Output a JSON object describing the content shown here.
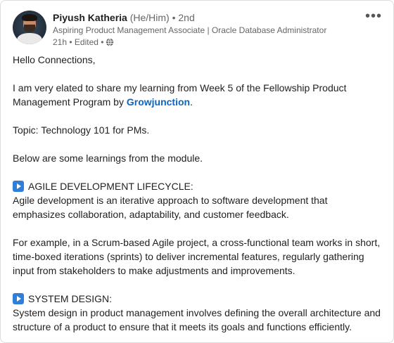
{
  "author": {
    "name": "Piyush Katheria",
    "pronouns": "(He/Him)",
    "degree": "• 2nd",
    "headline": "Aspiring Product Management Associate | Oracle Database Administrator",
    "time": "21h • Edited •",
    "visibility_icon": "globe-icon"
  },
  "menu_icon": "more-options-icon",
  "post": {
    "greeting": "Hello Connections,",
    "intro_before_link": "I am very elated to share my learning from Week 5 of the Fellowship Product Management Program by ",
    "intro_link": "Growjunction",
    "intro_after_link": ".",
    "topic": "Topic: Technology 101 for PMs.",
    "below": "Below are some learnings from the module.",
    "section1_heading": "AGILE DEVELOPMENT LIFECYCLE:",
    "section1_text": "Agile development is an iterative approach to software development that emphasizes collaboration, adaptability, and customer feedback.",
    "section1_example": "For example, in a Scrum-based Agile project, a cross-functional team works in short, time-boxed iterations (sprints) to deliver incremental features, regularly gathering input from stakeholders to make adjustments and improvements.",
    "section2_heading": "SYSTEM DESIGN:",
    "section2_text": "System design in product management involves defining the overall architecture and structure of a product to ensure that it meets its goals and functions efficiently."
  },
  "colors": {
    "link": "#0a66c2",
    "play_badge": "#2f7fd8",
    "secondary_text": "#666666"
  }
}
